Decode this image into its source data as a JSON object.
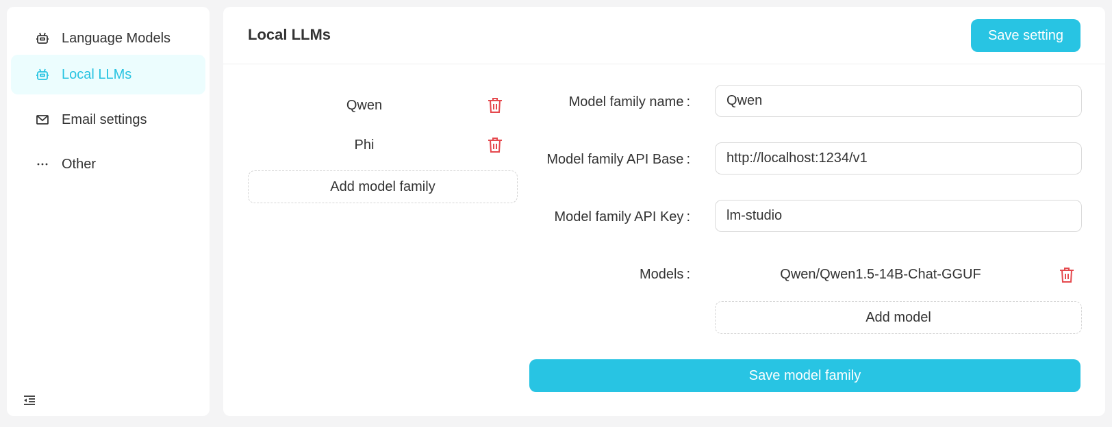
{
  "sidebar": {
    "items": [
      {
        "label": "Language Models",
        "icon": "robot-icon"
      },
      {
        "label": "Local LLMs",
        "icon": "robot-icon",
        "active": true
      },
      {
        "label": "Email settings",
        "icon": "mail-icon"
      },
      {
        "label": "Other",
        "icon": "ellipsis-icon"
      }
    ],
    "collapse_icon": "menu-fold-icon"
  },
  "header": {
    "title": "Local LLMs",
    "save_label": "Save setting"
  },
  "families": {
    "items": [
      {
        "name": "Qwen"
      },
      {
        "name": "Phi"
      }
    ],
    "add_label": "Add model family"
  },
  "form": {
    "name_label": "Model family name",
    "name_value": "Qwen",
    "api_base_label": "Model family API Base",
    "api_base_value": "http://localhost:1234/v1",
    "api_key_label": "Model family API Key",
    "api_key_value": "lm-studio",
    "models_label": "Models",
    "models": [
      {
        "name": "Qwen/Qwen1.5-14B-Chat-GGUF"
      }
    ],
    "add_model_label": "Add model",
    "save_family_label": "Save model family",
    "colon": ":"
  },
  "colors": {
    "accent": "#28c4e3",
    "active_bg": "#ecfdfe",
    "danger": "#e5484d"
  }
}
